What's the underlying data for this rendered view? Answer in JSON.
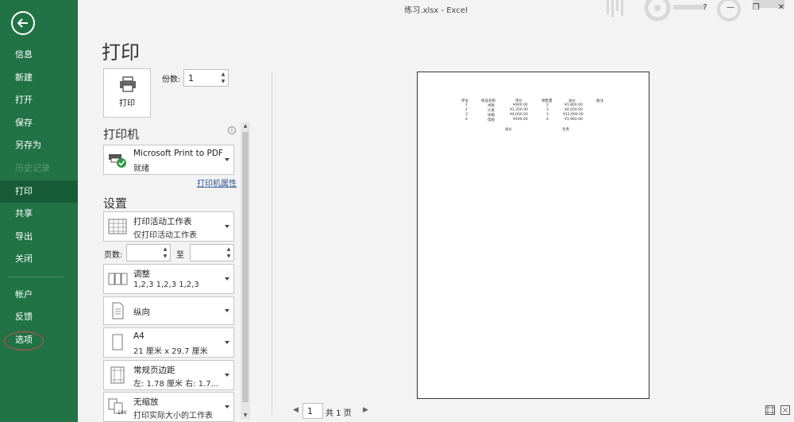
{
  "title": "练习.xlsx  -  Excel",
  "window_buttons": {
    "help": "?",
    "minimize": "—",
    "restore": "❐",
    "close": "✕"
  },
  "sidebar": {
    "items": [
      {
        "label": "信息"
      },
      {
        "label": "新建"
      },
      {
        "label": "打开"
      },
      {
        "label": "保存"
      },
      {
        "label": "另存为"
      },
      {
        "label": "历史记录"
      },
      {
        "label": "打印"
      },
      {
        "label": "共享"
      },
      {
        "label": "导出"
      },
      {
        "label": "关闭"
      },
      {
        "label": "帐户"
      },
      {
        "label": "反馈"
      },
      {
        "label": "选项"
      }
    ],
    "active": "打印",
    "accent": "#217346"
  },
  "page_title": "打印",
  "print_button": {
    "label": "打印"
  },
  "copies": {
    "label": "份数:",
    "value": "1"
  },
  "printer": {
    "section": "打印机",
    "name": "Microsoft Print to PDF",
    "status": "就绪",
    "properties_link": "打印机属性"
  },
  "settings": {
    "section": "设置",
    "scope": {
      "title": "打印活动工作表",
      "desc": "仅打印活动工作表"
    },
    "pages": {
      "label": "页数:",
      "to": "至"
    },
    "collate": {
      "title": "调整",
      "desc": "1,2,3    1,2,3    1,2,3"
    },
    "orientation": {
      "title": "纵向"
    },
    "paper": {
      "title": "A4",
      "desc": "21 厘米 x 29.7 厘米"
    },
    "margins": {
      "title": "常规页边距",
      "desc": "左: 1.78 厘米    右: 1.7..."
    },
    "scaling": {
      "title": "无缩放",
      "desc": "打印实际大小的工作表"
    }
  },
  "preview": {
    "headers": [
      "序号",
      "商品名称",
      "单价",
      "销售量",
      "总价",
      "备注"
    ],
    "rows": [
      [
        "1",
        "书架",
        "¥900.00",
        "2",
        "¥1,800.00"
      ],
      [
        "2",
        "沙发",
        "¥1,350.00",
        "3",
        "¥4,050.00"
      ],
      [
        "3",
        "冰箱",
        "¥4,000.00",
        "3",
        "¥12,000.00"
      ],
      [
        "4",
        "电视",
        "¥490.00",
        "4",
        "¥1,960.00"
      ]
    ],
    "footer_left": "总价",
    "footer_right": "负责"
  },
  "pager": {
    "current": "1",
    "total": "共 1 页",
    "prev": "◀",
    "next": "▶"
  }
}
